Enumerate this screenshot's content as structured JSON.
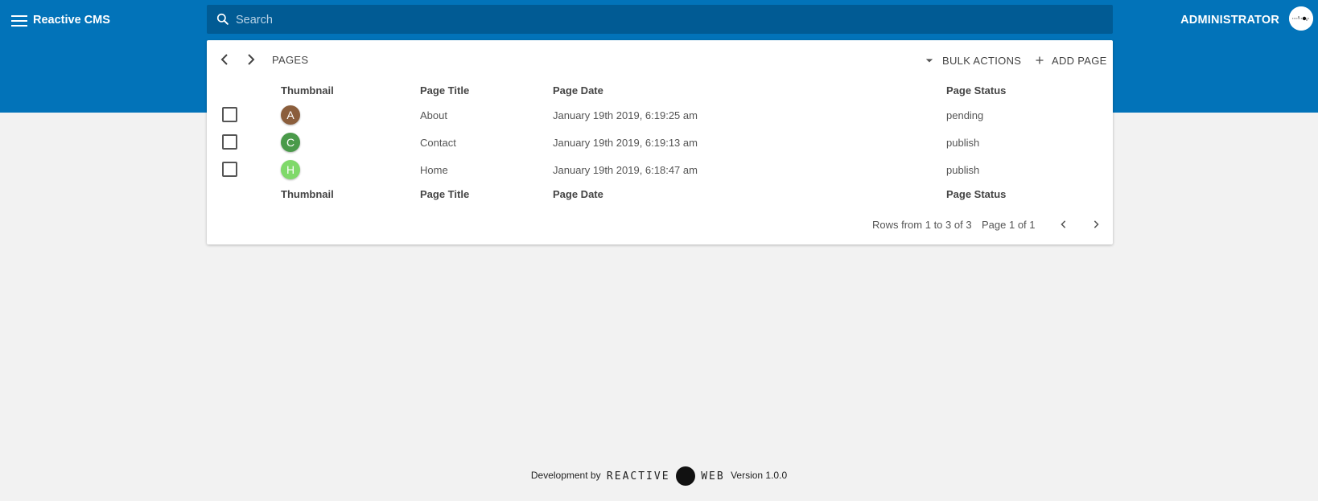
{
  "app": {
    "title": "Reactive CMS"
  },
  "search": {
    "placeholder": "Search",
    "value": ""
  },
  "user": {
    "label": "ADMINISTRATOR"
  },
  "card": {
    "title": "PAGES",
    "bulk_actions_label": "BULK ACTIONS",
    "add_page_label": "ADD PAGE"
  },
  "table": {
    "columns": [
      "Thumbnail",
      "Page Title",
      "Page Date",
      "Page Status"
    ],
    "rows": [
      {
        "thumb_letter": "A",
        "thumb_color": "#8b5e3c",
        "title": "About",
        "date": "January 19th 2019, 6:19:25 am",
        "status": "pending"
      },
      {
        "thumb_letter": "C",
        "thumb_color": "#4a9a4a",
        "title": "Contact",
        "date": "January 19th 2019, 6:19:13 am",
        "status": "publish"
      },
      {
        "thumb_letter": "H",
        "thumb_color": "#7fd96a",
        "title": "Home",
        "date": "January 19th 2019, 6:18:47 am",
        "status": "publish"
      }
    ]
  },
  "pager": {
    "rows_text": "Rows from 1 to 3 of 3",
    "page_text": "Page 1 of 1"
  },
  "footer": {
    "prefix": "Development by",
    "brand_left": "REACTIVE",
    "brand_right": "WEB",
    "version": "Version 1.0.0"
  },
  "colors": {
    "topbar": "#0273b9",
    "search_bg": "#015b94",
    "background": "#f2f2f2"
  }
}
